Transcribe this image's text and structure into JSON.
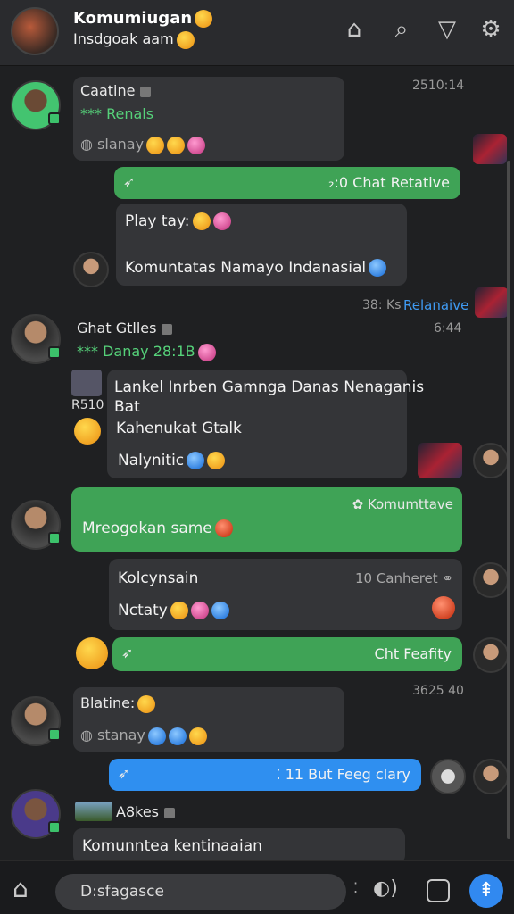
{
  "header": {
    "title": "Komumiugan",
    "subtitle": "Insdgoak aam",
    "icons": [
      "home-icon",
      "search-icon",
      "filter-icon",
      "settings-icon"
    ]
  },
  "messages": {
    "m1": {
      "name": "Caatine",
      "sub": "*** Renals",
      "status": "slanay",
      "time": "2510:14"
    },
    "m2": {
      "text": "₂:0 Chat Retative"
    },
    "m3": {
      "line1": "Play tay:",
      "line2": "Komuntatas Namayo Indanasial"
    },
    "m3meta": {
      "left": "38: Ks",
      "right": "Relanaive"
    },
    "m4": {
      "name": "Ghat Gtlles",
      "sub": "*** Danay 28:1B",
      "time": "6:44"
    },
    "m5": {
      "badge": "R510",
      "line1": "Lankel Inrben Gamnga Danas Nenaganis",
      "line2": "Bat",
      "line3": "Kahenukat Gtalk",
      "line4": "Nalynitic"
    },
    "m6": {
      "label": "Komumttave",
      "text": "Mreogokan same"
    },
    "m7": {
      "name": "Kolcynsain",
      "meta": "10 Canheret",
      "sub": "Nctaty"
    },
    "m8": {
      "text": "Cht Feafity"
    },
    "m9": {
      "name": "Blatine:",
      "status": "stanay",
      "time": "3625 40"
    },
    "m10": {
      "text": "11 But Feeg clary"
    },
    "m11": {
      "name": "A8kes",
      "text": "Komunntea kentinaaian"
    }
  },
  "input": {
    "placeholder": "D:sfagasce"
  },
  "colors": {
    "accent": "#3fa356",
    "blue": "#2f8ff0",
    "bg": "#1f2022"
  }
}
